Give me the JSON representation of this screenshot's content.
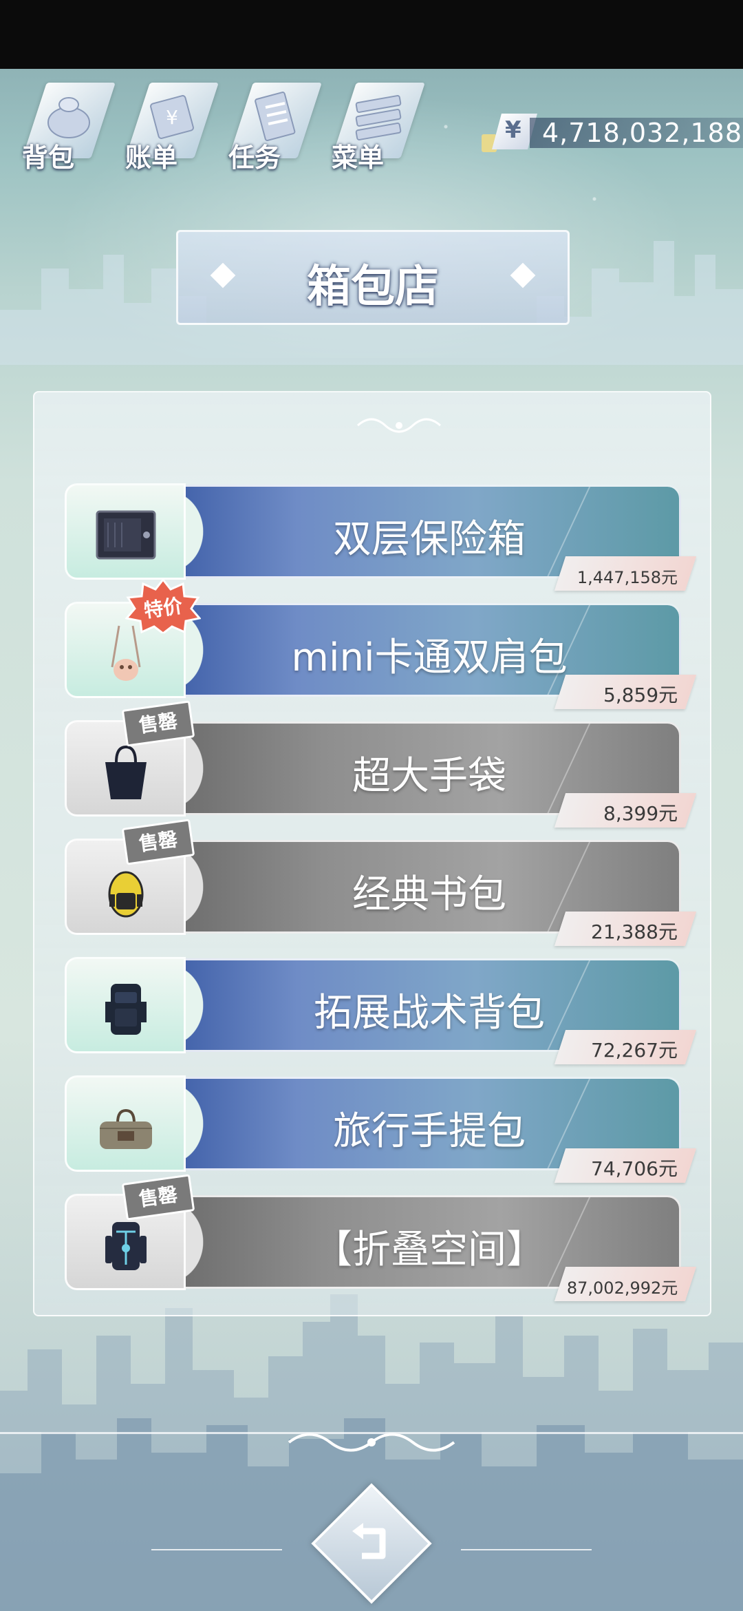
{
  "header": {
    "nav": [
      {
        "label": "背包",
        "icon": "bag-icon"
      },
      {
        "label": "账单",
        "icon": "bill-icon"
      },
      {
        "label": "任务",
        "icon": "task-icon"
      },
      {
        "label": "菜单",
        "icon": "menu-icon"
      }
    ],
    "money": {
      "currency_symbol": "¥",
      "amount": "4,718,032,188"
    }
  },
  "page_title": "箱包店",
  "shop": {
    "items": [
      {
        "name": "双层保险箱",
        "price": "1,447,158元",
        "status": "available",
        "badge": "",
        "icon": "safe-icon"
      },
      {
        "name": "mini卡通双肩包",
        "price": "5,859元",
        "status": "available",
        "badge": "特价",
        "icon": "cartoon-backpack-icon"
      },
      {
        "name": "超大手袋",
        "price": "8,399元",
        "status": "sold",
        "badge": "售罄",
        "icon": "tote-bag-icon"
      },
      {
        "name": "经典书包",
        "price": "21,388元",
        "status": "sold",
        "badge": "售罄",
        "icon": "school-bag-icon"
      },
      {
        "name": "拓展战术背包",
        "price": "72,267元",
        "status": "available",
        "badge": "",
        "icon": "tactical-backpack-icon"
      },
      {
        "name": "旅行手提包",
        "price": "74,706元",
        "status": "available",
        "badge": "",
        "icon": "travel-bag-icon"
      },
      {
        "name": "【折叠空间】",
        "price": "87,002,992元",
        "status": "sold",
        "badge": "售罄",
        "icon": "folding-space-icon"
      }
    ]
  },
  "footer": {
    "back_icon": "back-arrow-icon"
  }
}
